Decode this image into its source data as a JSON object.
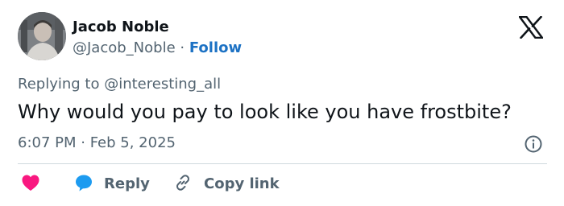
{
  "author": {
    "name": "Jacob Noble",
    "handle": "@Jacob_Noble",
    "separator": "·",
    "follow_label": "Follow"
  },
  "tweet": {
    "replying_to": "Replying to @interesting_all",
    "text": "Why would you pay to look like you have frostbite?",
    "timestamp": "6:07 PM · Feb 5, 2025"
  },
  "actions": {
    "reply_label": "Reply",
    "copy_link_label": "Copy link"
  },
  "icons": {
    "logo": "x-logo-icon",
    "info": "info-icon",
    "like": "heart-icon",
    "reply": "speech-bubble-icon",
    "copy": "link-icon"
  },
  "colors": {
    "follow": "#1d72c4",
    "heart": "#f91880",
    "reply_bubble": "#1d9bf0",
    "secondary_text": "#536471"
  }
}
